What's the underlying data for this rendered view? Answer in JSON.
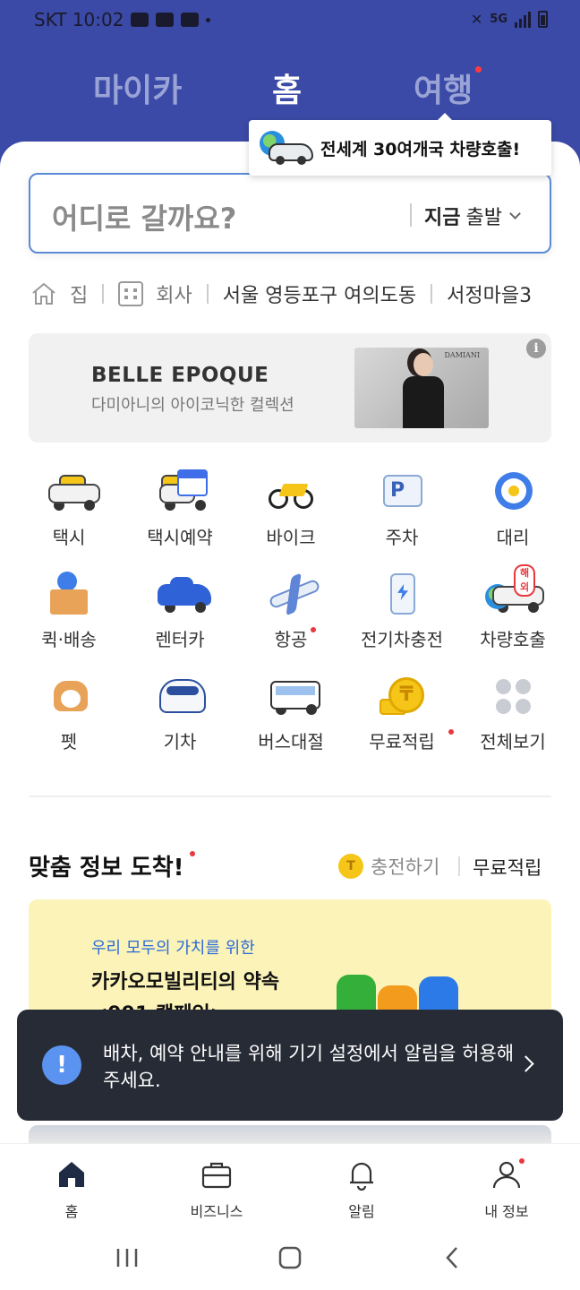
{
  "status_bar": {
    "carrier_time": "SKT 10:02",
    "network": "5G"
  },
  "top_tabs": [
    {
      "label": "마이카",
      "active": false
    },
    {
      "label": "홈",
      "active": true
    },
    {
      "label": "여행",
      "active": false,
      "has_badge": true
    }
  ],
  "tooltip": {
    "text": "전세계 30여개국 차량호출!",
    "icon": "globe-car-icon"
  },
  "search": {
    "placeholder": "어디로 갈까요?",
    "depart_bold": "지금",
    "depart_rest": "출발"
  },
  "shortcuts": [
    {
      "label": "집",
      "icon": "home-icon"
    },
    {
      "label": "회사",
      "icon": "office-icon"
    },
    {
      "label": "서울 영등포구 여의도동"
    },
    {
      "label": "서정마을3"
    }
  ],
  "banner": {
    "title": "BELLE EPOQUE",
    "subtitle": "다미아니의 아이코닉한 컬렉션",
    "image_brand": "DAMIANI",
    "info_glyph": "i"
  },
  "services": [
    {
      "label": "택시",
      "icon": "taxi-icon"
    },
    {
      "label": "택시예약",
      "icon": "taxi-reservation-icon"
    },
    {
      "label": "바이크",
      "icon": "bike-icon"
    },
    {
      "label": "주차",
      "icon": "parking-icon"
    },
    {
      "label": "대리",
      "icon": "designated-driver-icon"
    },
    {
      "label": "퀵·배송",
      "icon": "delivery-icon"
    },
    {
      "label": "렌터카",
      "icon": "rental-car-icon"
    },
    {
      "label": "항공",
      "icon": "airplane-icon",
      "badge": true
    },
    {
      "label": "전기차충전",
      "icon": "ev-charger-icon"
    },
    {
      "label": "차량호출",
      "icon": "overseas-car-icon",
      "tag": "해외"
    },
    {
      "label": "펫",
      "icon": "pet-icon"
    },
    {
      "label": "기차",
      "icon": "train-icon"
    },
    {
      "label": "버스대절",
      "icon": "bus-charter-icon"
    },
    {
      "label": "무료적립",
      "icon": "coin-icon",
      "badge": true
    },
    {
      "label": "전체보기",
      "icon": "view-all-icon"
    }
  ],
  "custom_info": {
    "title": "맞춤 정보 도착!",
    "charge_coin": "T",
    "charge_label": "충전하기",
    "free_label": "무료적립"
  },
  "promo": {
    "subtitle": "우리 모두의 가치를 위한",
    "title": "카카오모빌리티의 약속",
    "campaign": "<991 캠페인>"
  },
  "toast": {
    "icon_glyph": "!",
    "message": "배차, 예약 안내를 위해 기기 설정에서 알림을 허용해주세요."
  },
  "bottom_nav": [
    {
      "label": "홈",
      "icon": "home-icon",
      "active": true
    },
    {
      "label": "비즈니스",
      "icon": "briefcase-icon"
    },
    {
      "label": "알림",
      "icon": "bell-icon"
    },
    {
      "label": "내 정보",
      "icon": "person-icon",
      "badge": true
    }
  ],
  "colors": {
    "header_bg": "#3b4aa6",
    "accent_blue": "#5b8bd6",
    "badge_red": "#e8383d",
    "toast_bg": "#272b36",
    "promo_bg": "#fbf3b8"
  }
}
